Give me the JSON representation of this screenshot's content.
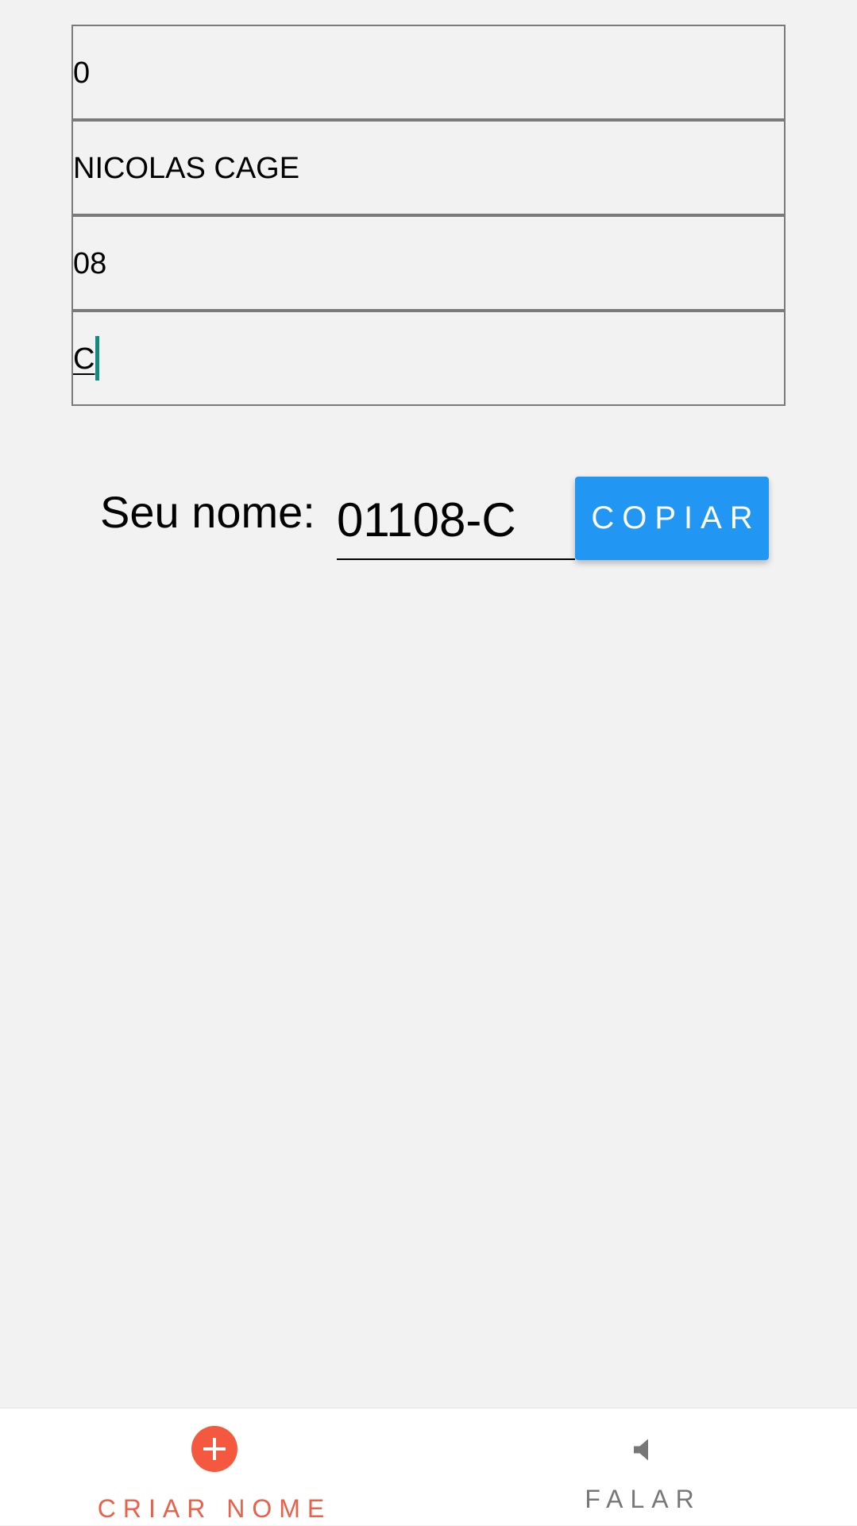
{
  "fields": [
    {
      "value": "0"
    },
    {
      "value": "NICOLAS CAGE"
    },
    {
      "value": "08"
    },
    {
      "value": "C"
    }
  ],
  "result": {
    "label": "Seu nome:",
    "value": "01108-C"
  },
  "copy_button": {
    "label": "COPIAR",
    "color": "#2196f3"
  },
  "bottom_nav": {
    "create": {
      "label": "CRIAR NOME",
      "icon": "plus-circle-icon",
      "color": "#f4593f"
    },
    "speak": {
      "label": "FALAR",
      "icon": "speaker-icon",
      "color": "#777777"
    }
  },
  "colors": {
    "background": "#f2f2f2",
    "caret": "#128c7e"
  }
}
